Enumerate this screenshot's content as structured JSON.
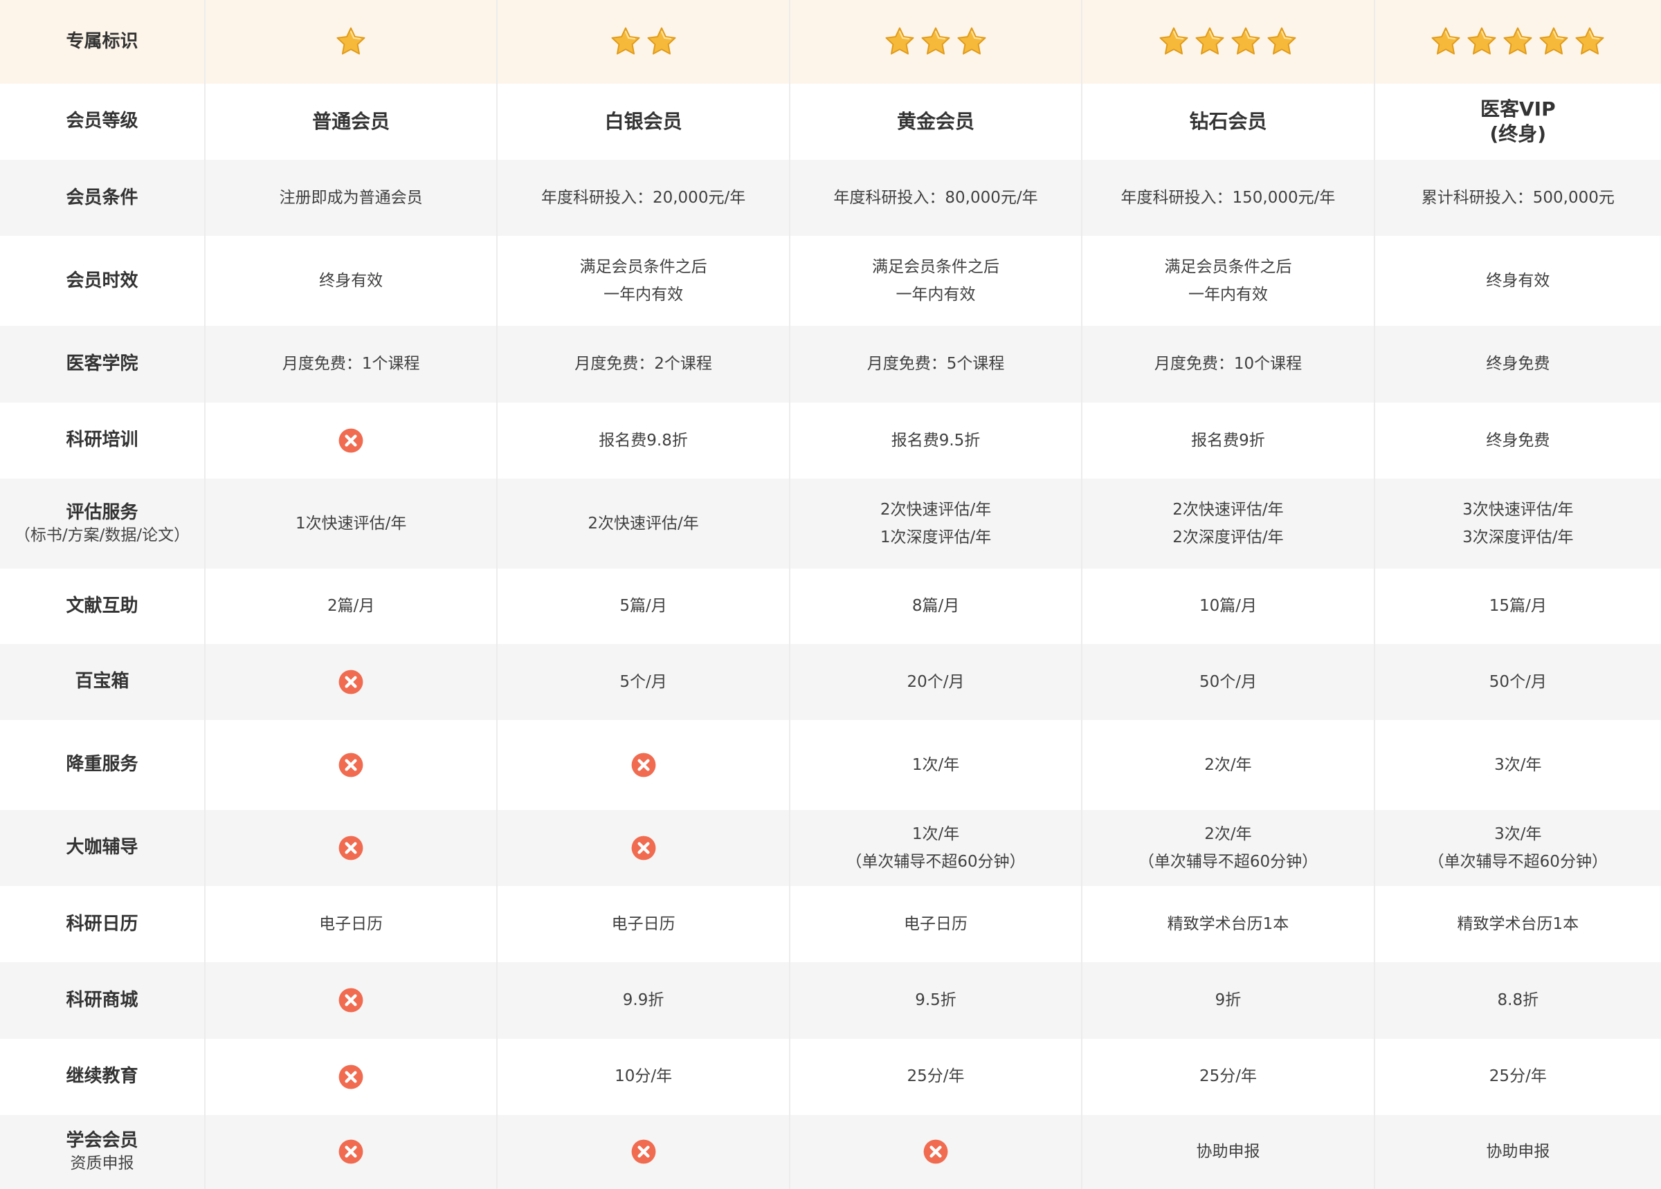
{
  "columns": [
    {
      "stars": 1,
      "name": "普通会员"
    },
    {
      "stars": 2,
      "name": "白银会员"
    },
    {
      "stars": 3,
      "name": "黄金会员"
    },
    {
      "stars": 4,
      "name": "钻石会员"
    },
    {
      "stars": 5,
      "name": "医客VIP\n(终身)"
    }
  ],
  "badge_label": "专属标识",
  "level_label": "会员等级",
  "colors": {
    "header_bg": "#fdf5ea",
    "stripe": "#f5f5f5",
    "star_fill": "#f6b93a",
    "star_edge": "#e09a18",
    "cross": "#f06b50"
  },
  "features": [
    {
      "label": [
        "会员条件"
      ],
      "values": [
        [
          "注册即成为普通会员"
        ],
        [
          "年度科研投入：20,000元/年"
        ],
        [
          "年度科研投入：80,000元/年"
        ],
        [
          "年度科研投入：150,000元/年"
        ],
        [
          "累计科研投入：500,000元"
        ]
      ]
    },
    {
      "label": [
        "会员时效"
      ],
      "values": [
        [
          "终身有效"
        ],
        [
          "满足会员条件之后",
          "一年内有效"
        ],
        [
          "满足会员条件之后",
          "一年内有效"
        ],
        [
          "满足会员条件之后",
          "一年内有效"
        ],
        [
          "终身有效"
        ]
      ]
    },
    {
      "label": [
        "医客学院"
      ],
      "values": [
        [
          "月度免费：1个课程"
        ],
        [
          "月度免费：2个课程"
        ],
        [
          "月度免费：5个课程"
        ],
        [
          "月度免费：10个课程"
        ],
        [
          "终身免费"
        ]
      ]
    },
    {
      "label": [
        "科研培训"
      ],
      "values": [
        null,
        [
          "报名费9.8折"
        ],
        [
          "报名费9.5折"
        ],
        [
          "报名费9折"
        ],
        [
          "终身免费"
        ]
      ]
    },
    {
      "label": [
        "评估服务",
        "（标书/方案/数据/论文）"
      ],
      "values": [
        [
          "1次快速评估/年"
        ],
        [
          "2次快速评估/年"
        ],
        [
          "2次快速评估/年",
          "1次深度评估/年"
        ],
        [
          "2次快速评估/年",
          "2次深度评估/年"
        ],
        [
          "3次快速评估/年",
          "3次深度评估/年"
        ]
      ]
    },
    {
      "label": [
        "文献互助"
      ],
      "values": [
        [
          "2篇/月"
        ],
        [
          "5篇/月"
        ],
        [
          "8篇/月"
        ],
        [
          "10篇/月"
        ],
        [
          "15篇/月"
        ]
      ]
    },
    {
      "label": [
        "百宝箱"
      ],
      "values": [
        null,
        [
          "5个/月"
        ],
        [
          "20个/月"
        ],
        [
          "50个/月"
        ],
        [
          "50个/月"
        ]
      ]
    },
    {
      "label": [
        "降重服务"
      ],
      "values": [
        null,
        null,
        [
          "1次/年"
        ],
        [
          "2次/年"
        ],
        [
          "3次/年"
        ]
      ]
    },
    {
      "label": [
        "大咖辅导"
      ],
      "values": [
        null,
        null,
        [
          "1次/年",
          "（单次辅导不超60分钟）"
        ],
        [
          "2次/年",
          "（单次辅导不超60分钟）"
        ],
        [
          "3次/年",
          "（单次辅导不超60分钟）"
        ]
      ]
    },
    {
      "label": [
        "科研日历"
      ],
      "values": [
        [
          "电子日历"
        ],
        [
          "电子日历"
        ],
        [
          "电子日历"
        ],
        [
          "精致学术台历1本"
        ],
        [
          "精致学术台历1本"
        ]
      ]
    },
    {
      "label": [
        "科研商城"
      ],
      "values": [
        null,
        [
          "9.9折"
        ],
        [
          "9.5折"
        ],
        [
          "9折"
        ],
        [
          "8.8折"
        ]
      ]
    },
    {
      "label": [
        "继续教育"
      ],
      "values": [
        null,
        [
          "10分/年"
        ],
        [
          "25分/年"
        ],
        [
          "25分/年"
        ],
        [
          "25分/年"
        ]
      ]
    },
    {
      "label": [
        "学会会员",
        "资质申报"
      ],
      "values": [
        null,
        null,
        null,
        [
          "协助申报"
        ],
        [
          "协助申报"
        ]
      ]
    }
  ]
}
